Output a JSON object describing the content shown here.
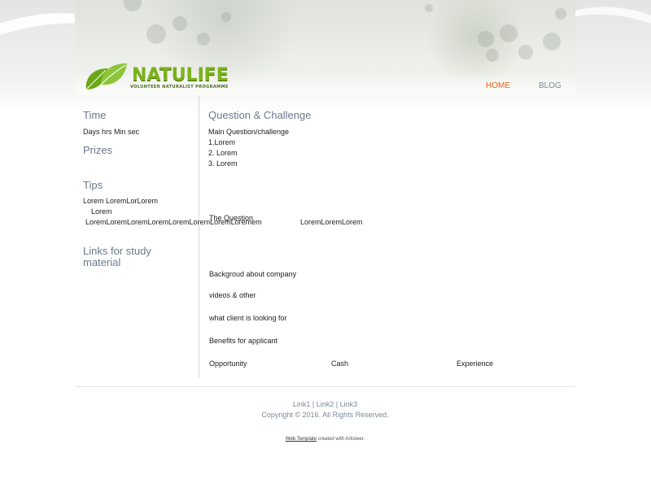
{
  "header": {
    "logo": {
      "name": "NATULIFE",
      "tagline": "VOLUNTEER NATURALIST PROGRAMME"
    },
    "nav": [
      {
        "label": "HOME"
      },
      {
        "label": "BLOG"
      }
    ]
  },
  "sidebar": {
    "time": {
      "title": "Time",
      "text": "Days hrs Min sec"
    },
    "prizes": {
      "title": "Prizes"
    },
    "tips": {
      "title": "Tips",
      "lines": [
        "Lorem LoremLorLorem",
        "Lorem",
        "LoremLoremLoremLoremLoremLoremLoremLoremem"
      ]
    },
    "links": {
      "title_line1": "Links for study",
      "title_line2": "material"
    }
  },
  "main": {
    "title": "Question & Challenge",
    "subtitle": "Main Question/challenge",
    "list": [
      "1.Lorem",
      "2. Lorem",
      "3. Lorem"
    ],
    "question": "The Question",
    "overflow": "LoremLoremLorem",
    "background": "Backgroud about company",
    "videos": "videos & other",
    "client": "what client is looking for",
    "benefits": "Benefits for applicant",
    "benefit_items": [
      "Opportunity",
      "Cash",
      "Experience"
    ]
  },
  "footer": {
    "links": [
      "Link1",
      "Link2",
      "Link3"
    ],
    "separator": "|",
    "copyright": "Copyright © 2016. All Rights Reserved.",
    "credit_link": "Web Template",
    "credit_text": "created with Artisteer."
  },
  "colors": {
    "accent_nav_active": "#e8601c",
    "heading": "#6b7a8c",
    "logo_green": "#7bb31a"
  }
}
